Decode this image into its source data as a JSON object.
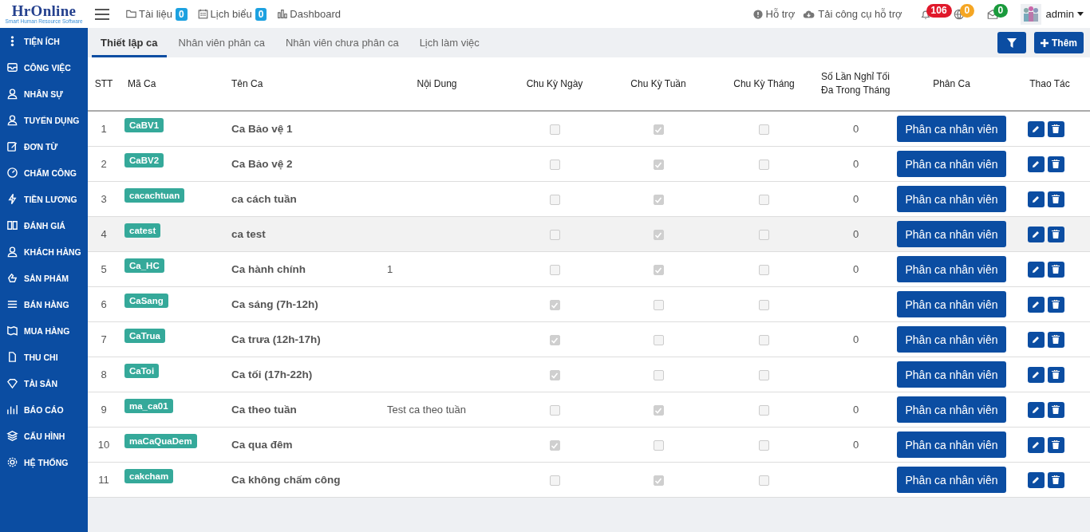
{
  "logo": {
    "name": "HrOnline",
    "tagline": "Smart Human Resource Software"
  },
  "topbar": {
    "links": [
      {
        "label": "Tài liệu",
        "badge": "0"
      },
      {
        "label": "Lịch biểu",
        "badge": "0"
      },
      {
        "label": "Dashboard"
      }
    ],
    "support": "Hỗ trợ",
    "download": "Tải công cụ hỗ trợ",
    "notifications": [
      {
        "count": "106",
        "color": "#e0192b"
      },
      {
        "count": "0",
        "color": "#f5a623"
      },
      {
        "count": "0",
        "color": "#1a9a3c"
      }
    ],
    "user": "admin"
  },
  "sidebar": {
    "items": [
      {
        "label": "TIỆN ÍCH"
      },
      {
        "label": "CÔNG VIỆC"
      },
      {
        "label": "NHÂN SỰ"
      },
      {
        "label": "TUYỂN DỤNG"
      },
      {
        "label": "ĐƠN TỪ"
      },
      {
        "label": "CHẤM CÔNG"
      },
      {
        "label": "TIỀN LƯƠNG"
      },
      {
        "label": "ĐÁNH GIÁ"
      },
      {
        "label": "KHÁCH HÀNG"
      },
      {
        "label": "SẢN PHẨM"
      },
      {
        "label": "BÁN HÀNG"
      },
      {
        "label": "MUA HÀNG"
      },
      {
        "label": "THU CHI"
      },
      {
        "label": "TÀI SẢN"
      },
      {
        "label": "BÁO CÁO"
      },
      {
        "label": "CẤU HÌNH"
      },
      {
        "label": "HỆ THỐNG"
      }
    ]
  },
  "tabs": [
    {
      "label": "Thiết lập ca",
      "selected": true
    },
    {
      "label": "Nhân viên phân ca",
      "selected": false
    },
    {
      "label": "Nhân viên chưa phân ca",
      "selected": false
    },
    {
      "label": "Lịch làm việc",
      "selected": false
    }
  ],
  "actions": {
    "add": "Thêm"
  },
  "table": {
    "columns": [
      "STT",
      "Mã Ca",
      "Tên Ca",
      "Nội Dung",
      "Chu Kỳ Ngày",
      "Chu Kỳ Tuần",
      "Chu Kỳ Tháng",
      "Số Lần Nghỉ Tối Đa Trong Tháng",
      "Phân Ca",
      "Thao Tác"
    ],
    "rows": [
      {
        "stt": "1",
        "code": "CaBV1",
        "name": "Ca Bảo vệ 1",
        "daily": false,
        "weekly": true,
        "monthly": false,
        "max_leave": "0",
        "assign": "Phân ca nhân viên",
        "hovered": false
      },
      {
        "stt": "2",
        "code": "CaBV2",
        "name": "Ca Bảo vệ 2",
        "daily": false,
        "weekly": true,
        "monthly": false,
        "max_leave": "0",
        "assign": "Phân ca nhân viên",
        "hovered": false
      },
      {
        "stt": "3",
        "code": "cacachtuan",
        "name": "ca cách tuần",
        "daily": false,
        "weekly": true,
        "monthly": false,
        "max_leave": "0",
        "assign": "Phân ca nhân viên",
        "hovered": false
      },
      {
        "stt": "4",
        "code": "catest",
        "name": "ca test",
        "daily": false,
        "weekly": true,
        "monthly": false,
        "max_leave": "0",
        "assign": "Phân ca nhân viên",
        "hovered": true
      },
      {
        "stt": "5",
        "code": "Ca_HC",
        "name": "Ca hành chính",
        "content": "1",
        "daily": false,
        "weekly": true,
        "monthly": false,
        "max_leave": "0",
        "assign": "Phân ca nhân viên",
        "hovered": false
      },
      {
        "stt": "6",
        "code": "CaSang",
        "name": "Ca sáng (7h-12h)",
        "daily": true,
        "weekly": false,
        "monthly": false,
        "assign": "Phân ca nhân viên",
        "hovered": false
      },
      {
        "stt": "7",
        "code": "CaTrua",
        "name": "Ca trưa (12h-17h)",
        "daily": true,
        "weekly": false,
        "monthly": false,
        "max_leave": "0",
        "assign": "Phân ca nhân viên",
        "hovered": false
      },
      {
        "stt": "8",
        "code": "CaToi",
        "name": "Ca tối (17h-22h)",
        "daily": true,
        "weekly": false,
        "monthly": false,
        "assign": "Phân ca nhân viên",
        "hovered": false
      },
      {
        "stt": "9",
        "code": "ma_ca01",
        "name": "Ca theo tuần",
        "content": "Test ca theo tuần",
        "daily": false,
        "weekly": true,
        "monthly": false,
        "max_leave": "0",
        "assign": "Phân ca nhân viên",
        "hovered": false
      },
      {
        "stt": "10",
        "code": "maCaQuaDem",
        "name": "Ca qua đêm",
        "daily": true,
        "weekly": false,
        "monthly": false,
        "max_leave": "0",
        "assign": "Phân ca nhân viên",
        "hovered": false
      },
      {
        "stt": "11",
        "code": "cakcham",
        "name": "Ca không chấm công",
        "daily": false,
        "weekly": true,
        "monthly": false,
        "assign": "Phân ca nhân viên",
        "hovered": false
      }
    ]
  }
}
